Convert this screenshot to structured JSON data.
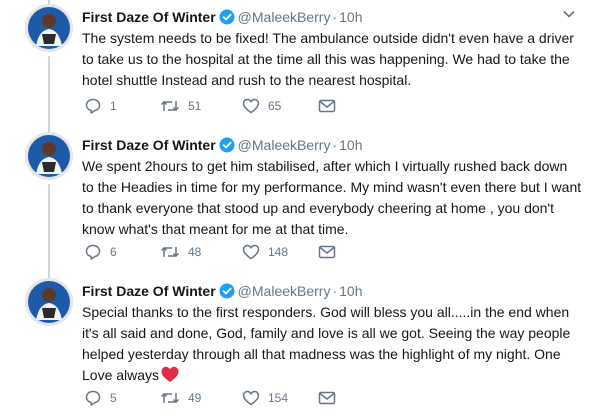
{
  "tweets": [
    {
      "name": "First Daze Of Winter",
      "handle": "@MaleekBerry",
      "dot": "·",
      "time": "10h",
      "text": "The system needs to be fixed! The ambulance outside didn't even have a driver to take us to the hospital at the time all this was happening. We had to take the hotel shuttle Instead and rush to the nearest hospital.",
      "replies": "1",
      "retweets": "51",
      "likes": "65"
    },
    {
      "name": "First Daze Of Winter",
      "handle": "@MaleekBerry",
      "dot": "·",
      "time": "10h",
      "text": "We spent 2hours to get him stabilised, after which I virtually rushed back down to the Headies in time for my performance. My mind wasn't even there but I want to thank everyone that stood up and everybody cheering at home , you don't know what's that meant for me at that time.",
      "replies": "6",
      "retweets": "48",
      "likes": "148"
    },
    {
      "name": "First Daze Of Winter",
      "handle": "@MaleekBerry",
      "dot": "·",
      "time": "10h",
      "text": "Special thanks to the first responders. God will bless you all.....in the end when it's all said and done, God, family and love is all we got. Seeing the way people helped yesterday through all that madness was the highlight of my night. One Love always",
      "replies": "5",
      "retweets": "49",
      "likes": "154"
    }
  ],
  "icons": {
    "verified": "verified-badge-icon",
    "caret": "chevron-down-icon",
    "reply": "reply-icon",
    "retweet": "retweet-icon",
    "like": "heart-icon",
    "dm": "envelope-icon",
    "emoji": "red-heart-emoji-icon"
  },
  "colors": {
    "verified": "#1da1f2",
    "icon": "#657786",
    "heart_emoji": "#dd2e44",
    "thread_line": "#ccd6dd"
  }
}
